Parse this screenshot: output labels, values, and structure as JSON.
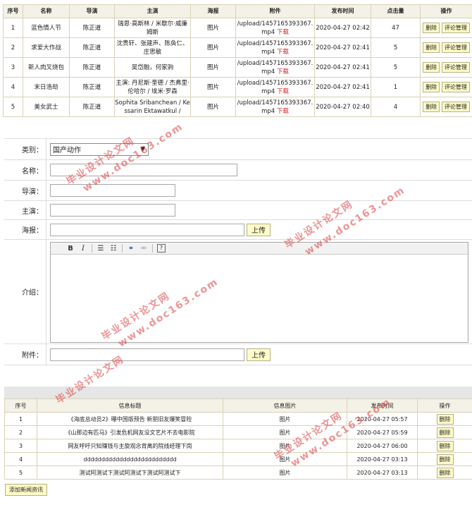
{
  "movies": {
    "headers": [
      "序号",
      "名称",
      "导演",
      "主演",
      "海报",
      "附件",
      "发布时间",
      "点击量",
      "操作"
    ],
    "rows": [
      {
        "no": "1",
        "name": "蓝色情人节",
        "director": "陈正道",
        "cast": "瑞恩·高斯林 / 米歇尔·威廉姆斯",
        "poster": "图片",
        "file": "/upload/1457165393367.mp4",
        "download": "下载",
        "time": "2020-04-27 02:42",
        "clicks": "47"
      },
      {
        "no": "2",
        "name": "求爱大作战",
        "director": "陈正道",
        "cast": "沈贵轩、张建声、陈奂仁、庄思敏",
        "poster": "图片",
        "file": "/upload/1457165393367.mp4",
        "download": "下载",
        "time": "2020-04-27 02:41",
        "clicks": "5"
      },
      {
        "no": "3",
        "name": "新人肉叉烧包",
        "director": "陈正道",
        "cast": "吴岱融，何家驹",
        "poster": "图片",
        "file": "/upload/1457165393367.mp4",
        "download": "下载",
        "time": "2020-04-27 02:41",
        "clicks": "5"
      },
      {
        "no": "4",
        "name": "末日浩劫",
        "director": "陈正道",
        "cast": "主演: 丹尼斯·奎德 / 杰弗里·伦哈尔 / 埃米·罗森",
        "poster": "图片",
        "file": "/upload/1457165393367.mp4",
        "download": "下载",
        "time": "2020-04-27 02:41",
        "clicks": "1"
      },
      {
        "no": "5",
        "name": "美女武士",
        "director": "陈正道",
        "cast": "Sophita Sribanchean / Kessarin Ektawatkul /",
        "poster": "图片",
        "file": "/upload/1457165393367.mp4",
        "download": "下载",
        "time": "2020-04-27 02:40",
        "clicks": "4"
      }
    ],
    "delete_label": "删除",
    "comment_label": "评论管理"
  },
  "form": {
    "category_label": "类别：",
    "category_value": "国产动作",
    "name_label": "名称：",
    "director_label": "导演：",
    "cast_label": "主演：",
    "poster_label": "海报：",
    "upload_label": "上传",
    "intro_label": "介绍：",
    "attach_label": "附件：",
    "toolbar": {
      "bold": "B",
      "italic": "I",
      "help": "?"
    }
  },
  "news": {
    "headers": [
      "序号",
      "信息标题",
      "信息图片",
      "发布时间",
      "操作"
    ],
    "rows": [
      {
        "no": "1",
        "title": "《海底总动员2》曝中国版预告 新朋旧友爆笑冒险",
        "img": "图片",
        "time": "2020-04-27 05:57"
      },
      {
        "no": "2",
        "title": "《山那边有匹马》引发危机网友没文艺片不去电影院",
        "img": "图片",
        "time": "2020-04-27 05:59"
      },
      {
        "no": "3",
        "title": "网友呼吁只知赚钱与主旋观念背离的院线经理下岗",
        "img": "图片",
        "time": "2020-04-27 06:00"
      },
      {
        "no": "4",
        "title": "dddddddddddddddddddddddddd",
        "img": "图片",
        "time": "2020-04-27 03:13"
      },
      {
        "no": "5",
        "title": "测试阿测试下测试阿测试下测试阿测试下",
        "img": "图片",
        "time": "2020-04-27 03:13"
      }
    ],
    "delete_label": "删除",
    "add_label": "添加新闻资讯"
  },
  "watermark": {
    "cn": "毕业设计论文网",
    "url": "www.doc163.com"
  }
}
